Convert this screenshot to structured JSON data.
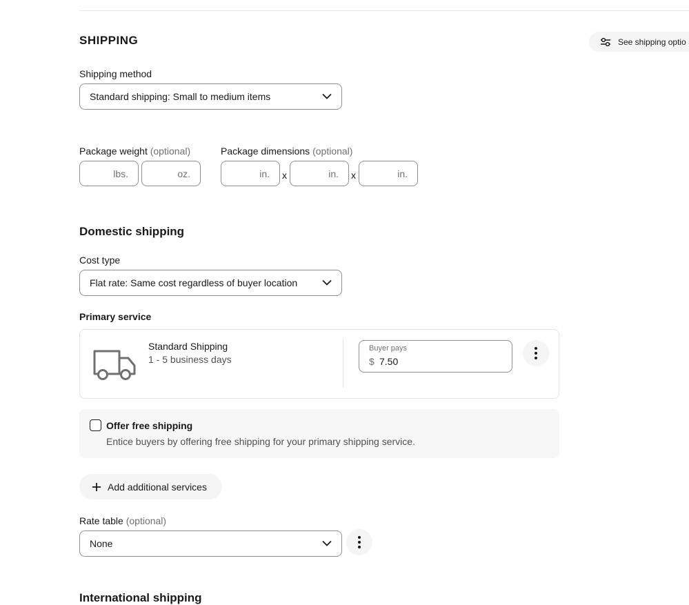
{
  "header": {
    "title": "SHIPPING",
    "see_options_label": "See shipping optio",
    "options_icon": "sliders-icon"
  },
  "shipping_method": {
    "label": "Shipping method",
    "selected": "Standard shipping: Small to medium items"
  },
  "package_weight": {
    "label": "Package weight",
    "optional": "(optional)",
    "units": [
      "lbs.",
      "oz."
    ]
  },
  "package_dimensions": {
    "label": "Package dimensions",
    "optional": "(optional)",
    "unit": "in.",
    "separator": "x"
  },
  "domestic": {
    "heading": "Domestic shipping",
    "cost_type_label": "Cost type",
    "cost_type_selected": "Flat rate: Same cost regardless of buyer location",
    "primary_service_label": "Primary service",
    "service": {
      "name": "Standard Shipping",
      "delivery": "1 - 5 business days",
      "icon": "truck-icon",
      "buyer_pays_label": "Buyer pays",
      "currency": "$",
      "price": "7.50"
    },
    "free_shipping": {
      "title": "Offer free shipping",
      "description": "Entice buyers by offering free shipping for your primary shipping service.",
      "checked": false
    },
    "add_services_label": "Add additional services",
    "rate_table": {
      "label": "Rate table",
      "optional": "(optional)",
      "selected": "None"
    }
  },
  "international": {
    "heading": "International shipping"
  }
}
